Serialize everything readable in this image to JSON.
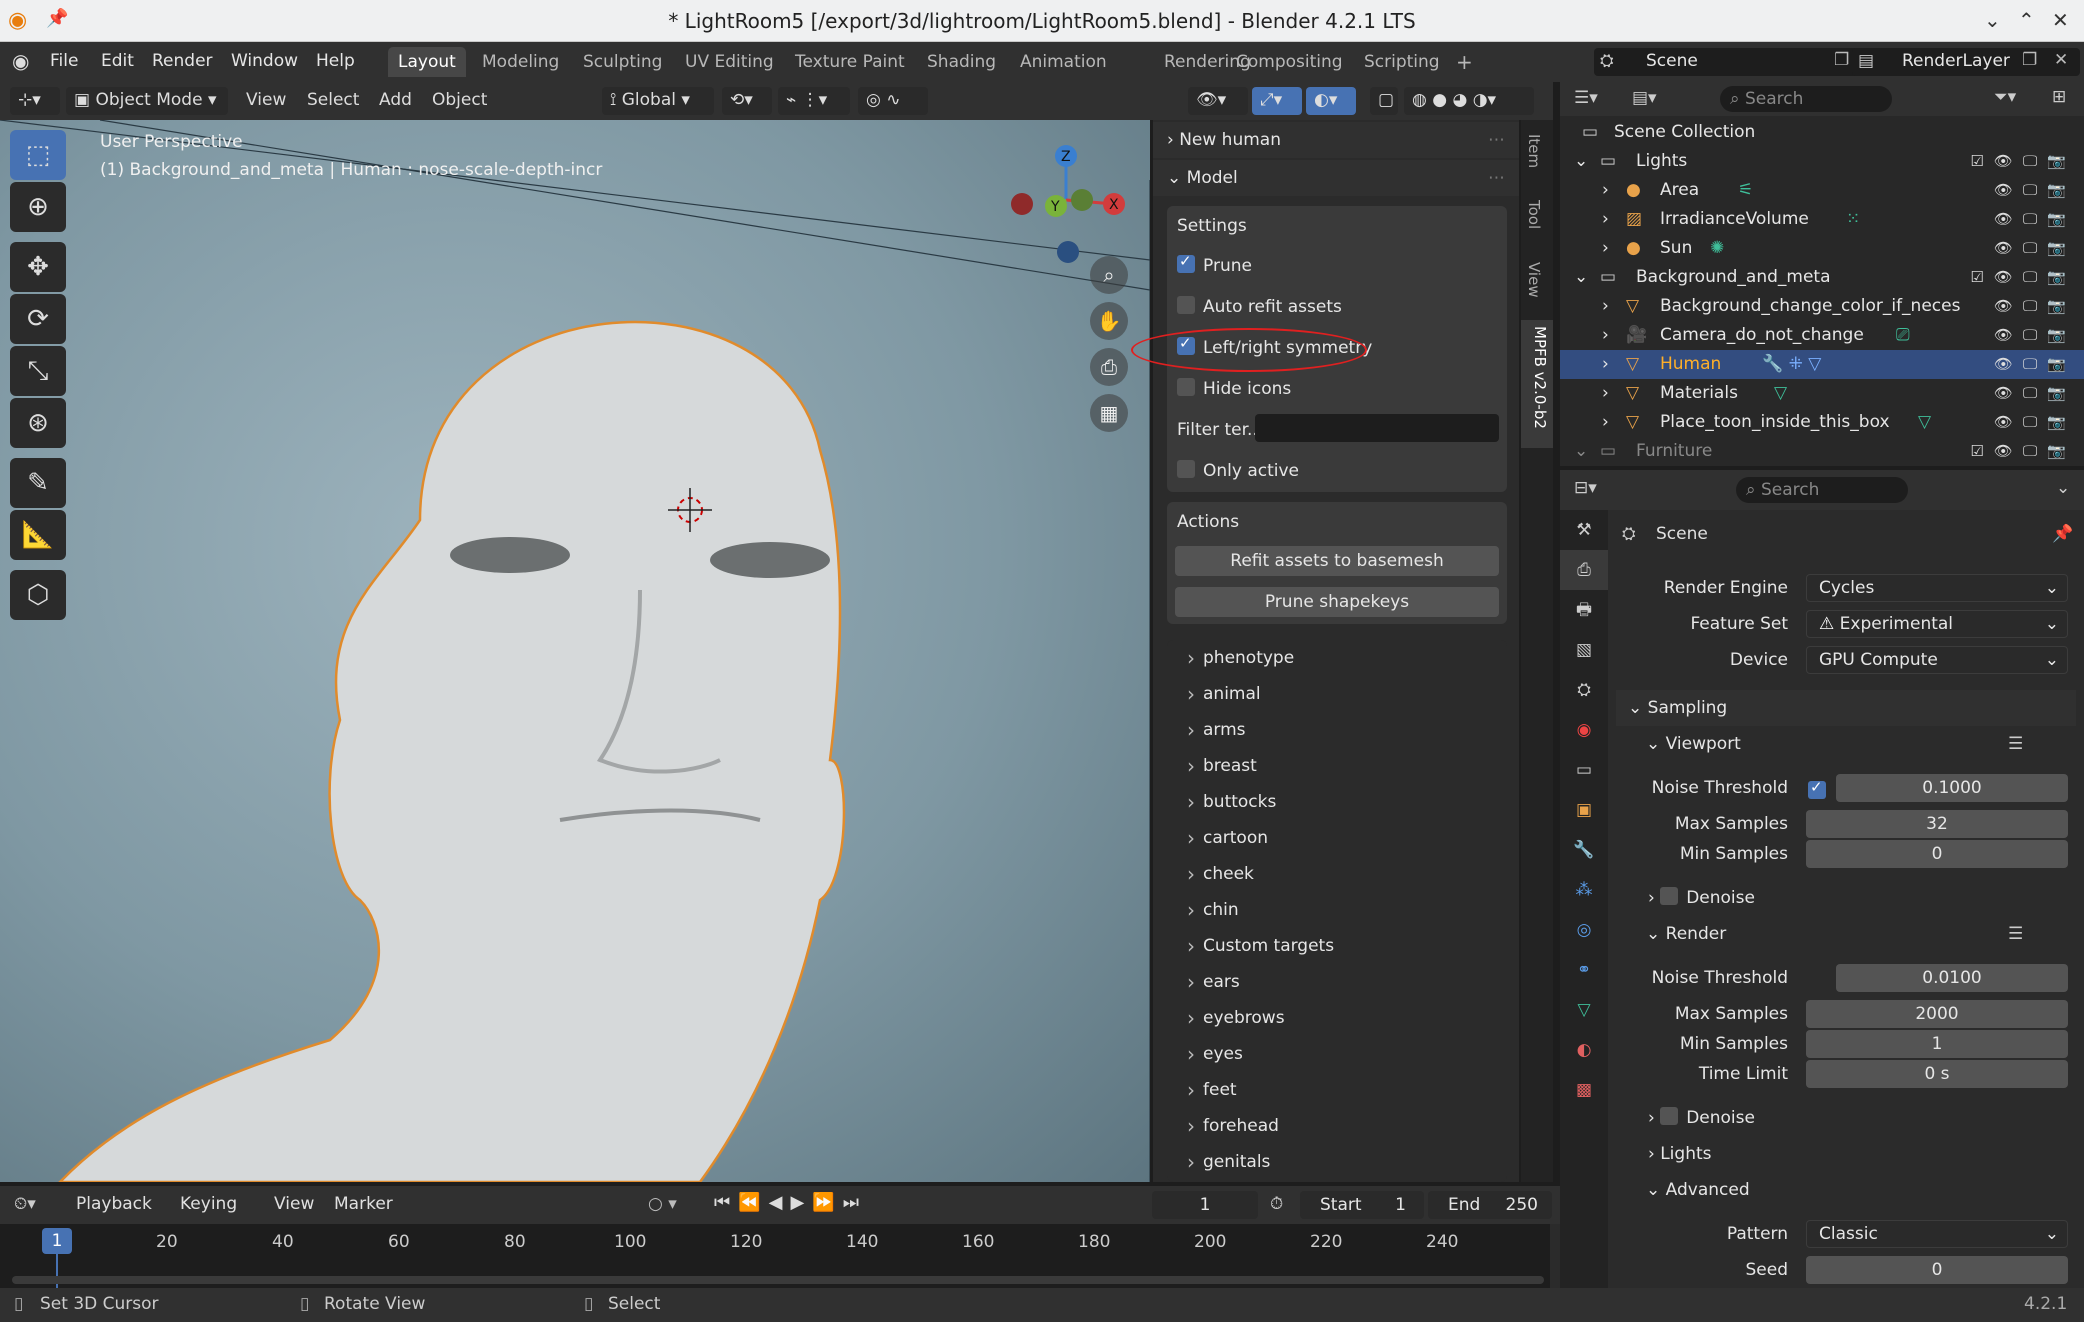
{
  "window": {
    "title": "* LightRoom5 [/export/3d/lightroom/LightRoom5.blend] - Blender 4.2.1 LTS",
    "min": "⌄",
    "max": "⌃",
    "close": "✕"
  },
  "menu": [
    "File",
    "Edit",
    "Render",
    "Window",
    "Help"
  ],
  "workspaces": [
    "Layout",
    "Modeling",
    "Sculpting",
    "UV Editing",
    "Texture Paint",
    "Shading",
    "Animation",
    "Rendering",
    "Compositing",
    "Scripting"
  ],
  "scene": {
    "label": "Scene",
    "renderlayer": "RenderLayer"
  },
  "viewport_header": {
    "mode": "Object Mode",
    "view": "View",
    "select": "Select",
    "add": "Add",
    "object": "Object",
    "transform": "Global"
  },
  "viewport": {
    "perspective": "User Perspective",
    "info": "(1) Background_and_meta | Human : nose-scale-depth-incr",
    "gizmo": {
      "x": "X",
      "y": "Y",
      "z": "Z"
    }
  },
  "npanel": {
    "new_human": "New human",
    "model": "Model",
    "settings": "Settings",
    "prune": "Prune",
    "auto_refit": "Auto refit assets",
    "symmetry": "Left/right symmetry",
    "hide_icons": "Hide icons",
    "filter": "Filter ter...",
    "only_active": "Only active",
    "actions": "Actions",
    "refit_btn": "Refit assets to basemesh",
    "prune_btn": "Prune shapekeys",
    "categories": [
      "phenotype",
      "animal",
      "arms",
      "breast",
      "buttocks",
      "cartoon",
      "cheek",
      "chin",
      "Custom targets",
      "ears",
      "eyebrows",
      "eyes",
      "feet",
      "forehead",
      "genitals"
    ],
    "tabs": [
      "Item",
      "Tool",
      "View",
      "MPFB v2.0-b2"
    ]
  },
  "outliner": {
    "search": "Search",
    "rows": [
      {
        "name": "Scene Collection"
      },
      {
        "name": "Lights"
      },
      {
        "name": "Area"
      },
      {
        "name": "IrradianceVolume"
      },
      {
        "name": "Sun"
      },
      {
        "name": "Background_and_meta"
      },
      {
        "name": "Background_change_color_if_neces"
      },
      {
        "name": "Camera_do_not_change"
      },
      {
        "name": "Human"
      },
      {
        "name": "Materials"
      },
      {
        "name": "Place_toon_inside_this_box"
      },
      {
        "name": "Furniture"
      }
    ]
  },
  "properties": {
    "search": "Search",
    "context": "Scene",
    "render_engine_label": "Render Engine",
    "render_engine": "Cycles",
    "feature_set_label": "Feature Set",
    "feature_set": "Experimental",
    "device_label": "Device",
    "device": "GPU Compute",
    "sampling": "Sampling",
    "viewport": "Viewport",
    "noise_threshold_label": "Noise Threshold",
    "vp_noise": "0.1000",
    "max_samples_label": "Max Samples",
    "vp_max": "32",
    "min_samples_label": "Min Samples",
    "vp_min": "0",
    "denoise": "Denoise",
    "render": "Render",
    "r_noise": "0.0100",
    "r_max": "2000",
    "r_min": "1",
    "time_limit_label": "Time Limit",
    "time_limit": "0 s",
    "lights": "Lights",
    "advanced": "Advanced",
    "pattern_label": "Pattern",
    "pattern": "Classic",
    "seed_label": "Seed",
    "seed": "0"
  },
  "timeline": {
    "playback": "Playback",
    "keying": "Keying",
    "view": "View",
    "marker": "Marker",
    "frame": "1",
    "start_label": "Start",
    "start": "1",
    "end_label": "End",
    "end": "250",
    "current": "1",
    "ticks": [
      "20",
      "40",
      "60",
      "80",
      "100",
      "120",
      "140",
      "160",
      "180",
      "200",
      "220",
      "240"
    ]
  },
  "status": {
    "cursor": "Set 3D Cursor",
    "rotate": "Rotate View",
    "select": "Select",
    "version": "4.2.1"
  }
}
